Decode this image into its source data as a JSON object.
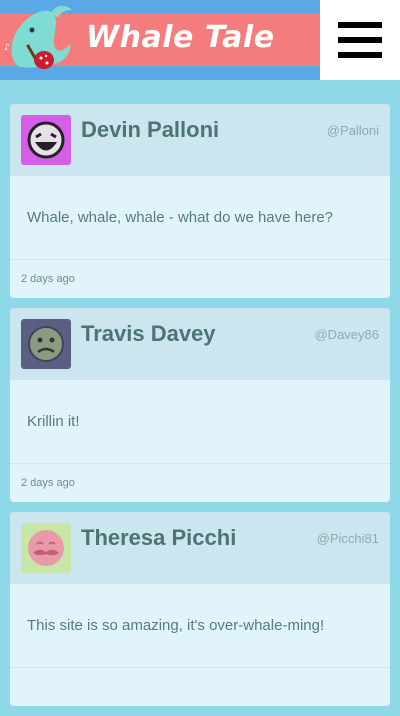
{
  "header": {
    "title": "Whale Tale",
    "logo_icon": "whale-with-guitar",
    "menu_icon": "hamburger-menu-icon"
  },
  "posts": [
    {
      "name": "Devin Palloni",
      "handle": "@Palloni",
      "text": "Whale, whale, whale - what do we have here?",
      "time": "2 days ago",
      "avatar_icon": "laughing-face",
      "avatar_color": "#d45fe6"
    },
    {
      "name": "Travis Davey",
      "handle": "@Davey86",
      "text": "Krillin it!",
      "time": "2 days ago",
      "avatar_icon": "worried-face",
      "avatar_color": "#5a5f82"
    },
    {
      "name": "Theresa Picchi",
      "handle": "@Picchi81",
      "text": "This site is so amazing, it's over-whale-ming!",
      "time": "",
      "avatar_icon": "mustache-face",
      "avatar_color": "#c8e6a8"
    }
  ],
  "colors": {
    "page_bg": "#8ed8e8",
    "header_blue": "#5aa8e6",
    "header_red": "#f47c7c",
    "card_bg": "#e0f4f9",
    "card_header_bg": "#cbe6ee",
    "name_color": "#4c7572"
  }
}
